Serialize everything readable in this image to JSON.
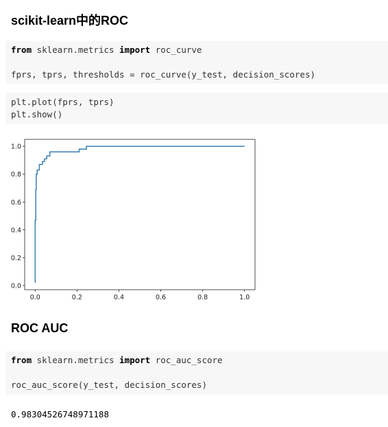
{
  "sections": {
    "roc_title": "scikit-learn中的ROC",
    "auc_title": "ROC AUC"
  },
  "cell1": {
    "kw1": "from",
    "t1": " sklearn.metrics ",
    "kw2": "import",
    "t2": " roc_curve",
    "line2": "fprs, tprs, thresholds = roc_curve(y_test, decision_scores)"
  },
  "cell2": {
    "line1": "plt.plot(fprs, tprs)",
    "line2": "plt.show()"
  },
  "cell3": {
    "kw1": "from",
    "t1": " sklearn.metrics ",
    "kw2": "import",
    "t2": " roc_auc_score",
    "line2": "roc_auc_score(y_test, decision_scores)"
  },
  "output3": "0.98304526748971188",
  "chart_data": {
    "type": "line",
    "title": "",
    "xlabel": "",
    "ylabel": "",
    "xlim": [
      -0.05,
      1.05
    ],
    "ylim": [
      -0.03,
      1.05
    ],
    "xticks": [
      "0.0",
      "0.2",
      "0.4",
      "0.6",
      "0.8",
      "1.0"
    ],
    "yticks": [
      "0.0",
      "0.2",
      "0.4",
      "0.6",
      "0.8",
      "1.0"
    ],
    "grid": false,
    "color": "#3a7fb0",
    "x": [
      0,
      0,
      0.003,
      0.003,
      0.005,
      0.005,
      0.01,
      0.01,
      0.02,
      0.02,
      0.035,
      0.035,
      0.045,
      0.045,
      0.055,
      0.055,
      0.07,
      0.07,
      0.21,
      0.21,
      0.245,
      0.245,
      1.0
    ],
    "y": [
      0.02,
      0.47,
      0.47,
      0.69,
      0.69,
      0.8,
      0.8,
      0.83,
      0.83,
      0.87,
      0.87,
      0.89,
      0.89,
      0.91,
      0.91,
      0.93,
      0.93,
      0.96,
      0.96,
      0.98,
      0.98,
      1.0,
      1.0
    ]
  }
}
